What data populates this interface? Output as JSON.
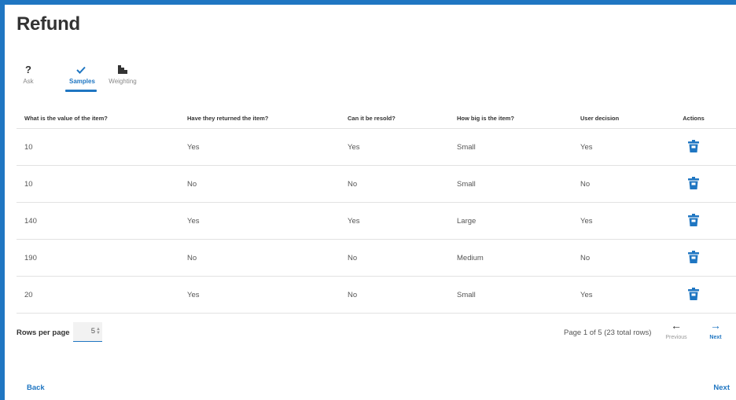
{
  "page": {
    "title": "Refund"
  },
  "tabs": [
    {
      "label": "Ask",
      "icon": "question-icon",
      "active": false
    },
    {
      "label": "Samples",
      "icon": "check-icon",
      "active": true
    },
    {
      "label": "Weighting",
      "icon": "bar-chart-icon",
      "active": false
    }
  ],
  "table": {
    "headers": [
      "What is the value of the item?",
      "Have they returned the item?",
      "Can it be resold?",
      "How big is the item?",
      "User decision",
      "Actions"
    ],
    "rows": [
      [
        "10",
        "Yes",
        "Yes",
        "Small",
        "Yes"
      ],
      [
        "10",
        "No",
        "No",
        "Small",
        "No"
      ],
      [
        "140",
        "Yes",
        "Yes",
        "Large",
        "Yes"
      ],
      [
        "190",
        "No",
        "No",
        "Medium",
        "No"
      ],
      [
        "20",
        "Yes",
        "No",
        "Small",
        "Yes"
      ]
    ],
    "action_icon": "trash-icon"
  },
  "pagination": {
    "rows_per_page_label": "Rows per page",
    "rows_per_page_value": "5",
    "page_info": "Page 1 of 5 (23 total rows)",
    "previous_label": "Previous",
    "next_label": "Next"
  },
  "footer": {
    "back_label": "Back",
    "next_label": "Next"
  },
  "colors": {
    "accent": "#1f76c2",
    "text": "#333333",
    "muted": "#888888",
    "divider": "#e2e2e2"
  }
}
